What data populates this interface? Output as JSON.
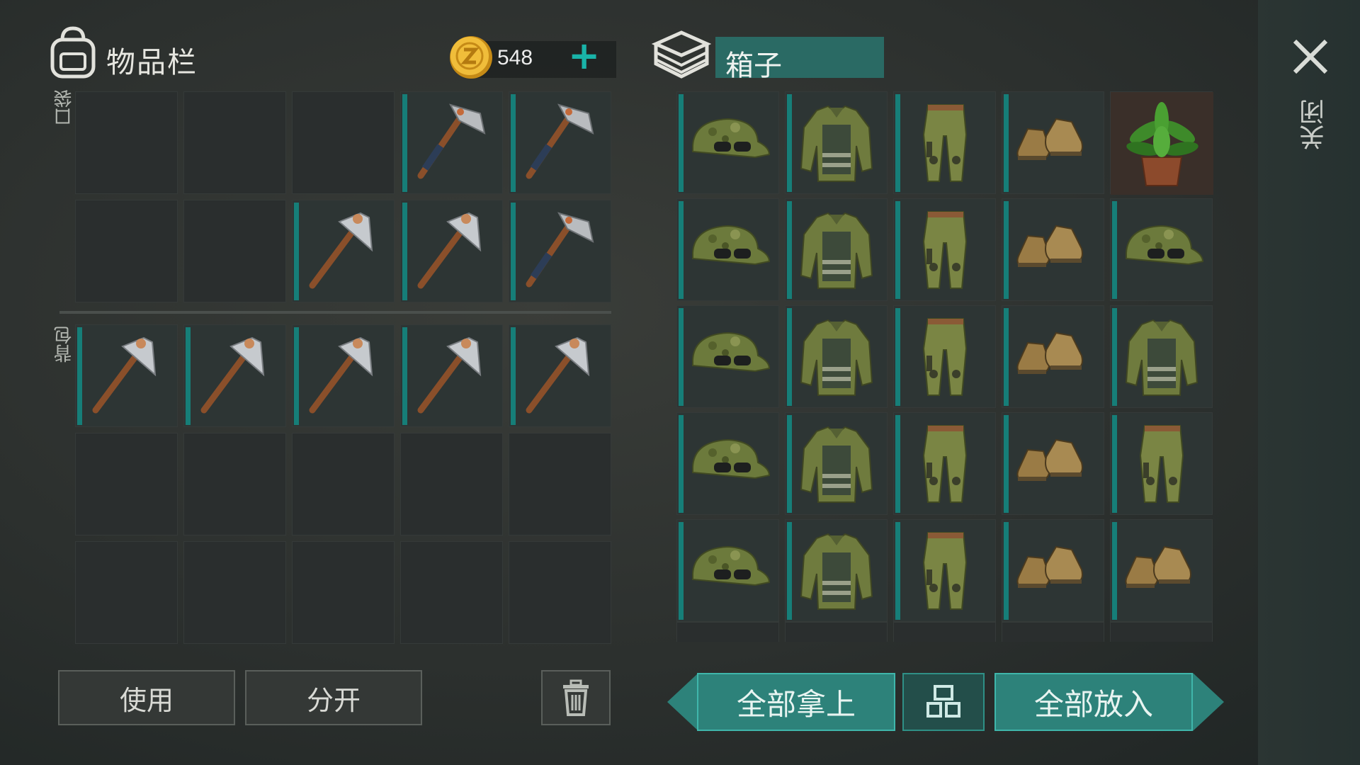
{
  "inventory": {
    "title": "物品栏",
    "currency_icon": "z-coin-icon",
    "currency_amount": "548",
    "add_currency_label": "+",
    "pocket_label": "口袋",
    "backpack_label": "背包",
    "pocket_slots": [
      "",
      "",
      "",
      "axe",
      "axe",
      "",
      "",
      "pickaxe",
      "pickaxe",
      "axe"
    ],
    "backpack_slots": [
      "pickaxe",
      "pickaxe",
      "pickaxe",
      "pickaxe",
      "pickaxe",
      "",
      "",
      "",
      "",
      "",
      "",
      "",
      "",
      "",
      ""
    ]
  },
  "box": {
    "title": "箱子",
    "icon": "box-icon",
    "slots": [
      "cap",
      "jacket",
      "pants",
      "boots",
      "plant",
      "cap",
      "jacket",
      "pants",
      "boots",
      "cap",
      "cap",
      "jacket",
      "pants",
      "boots",
      "jacket",
      "cap",
      "jacket",
      "pants",
      "boots",
      "pants",
      "cap",
      "jacket",
      "pants",
      "boots",
      "boots"
    ]
  },
  "actions": {
    "use": "使用",
    "split": "分开",
    "take_all": "全部拿上",
    "put_all": "全部放入",
    "close": "关闭"
  },
  "colors": {
    "accent": "#2d827a",
    "accent_light": "#3fb6ab",
    "coin": "#e0a92a"
  }
}
